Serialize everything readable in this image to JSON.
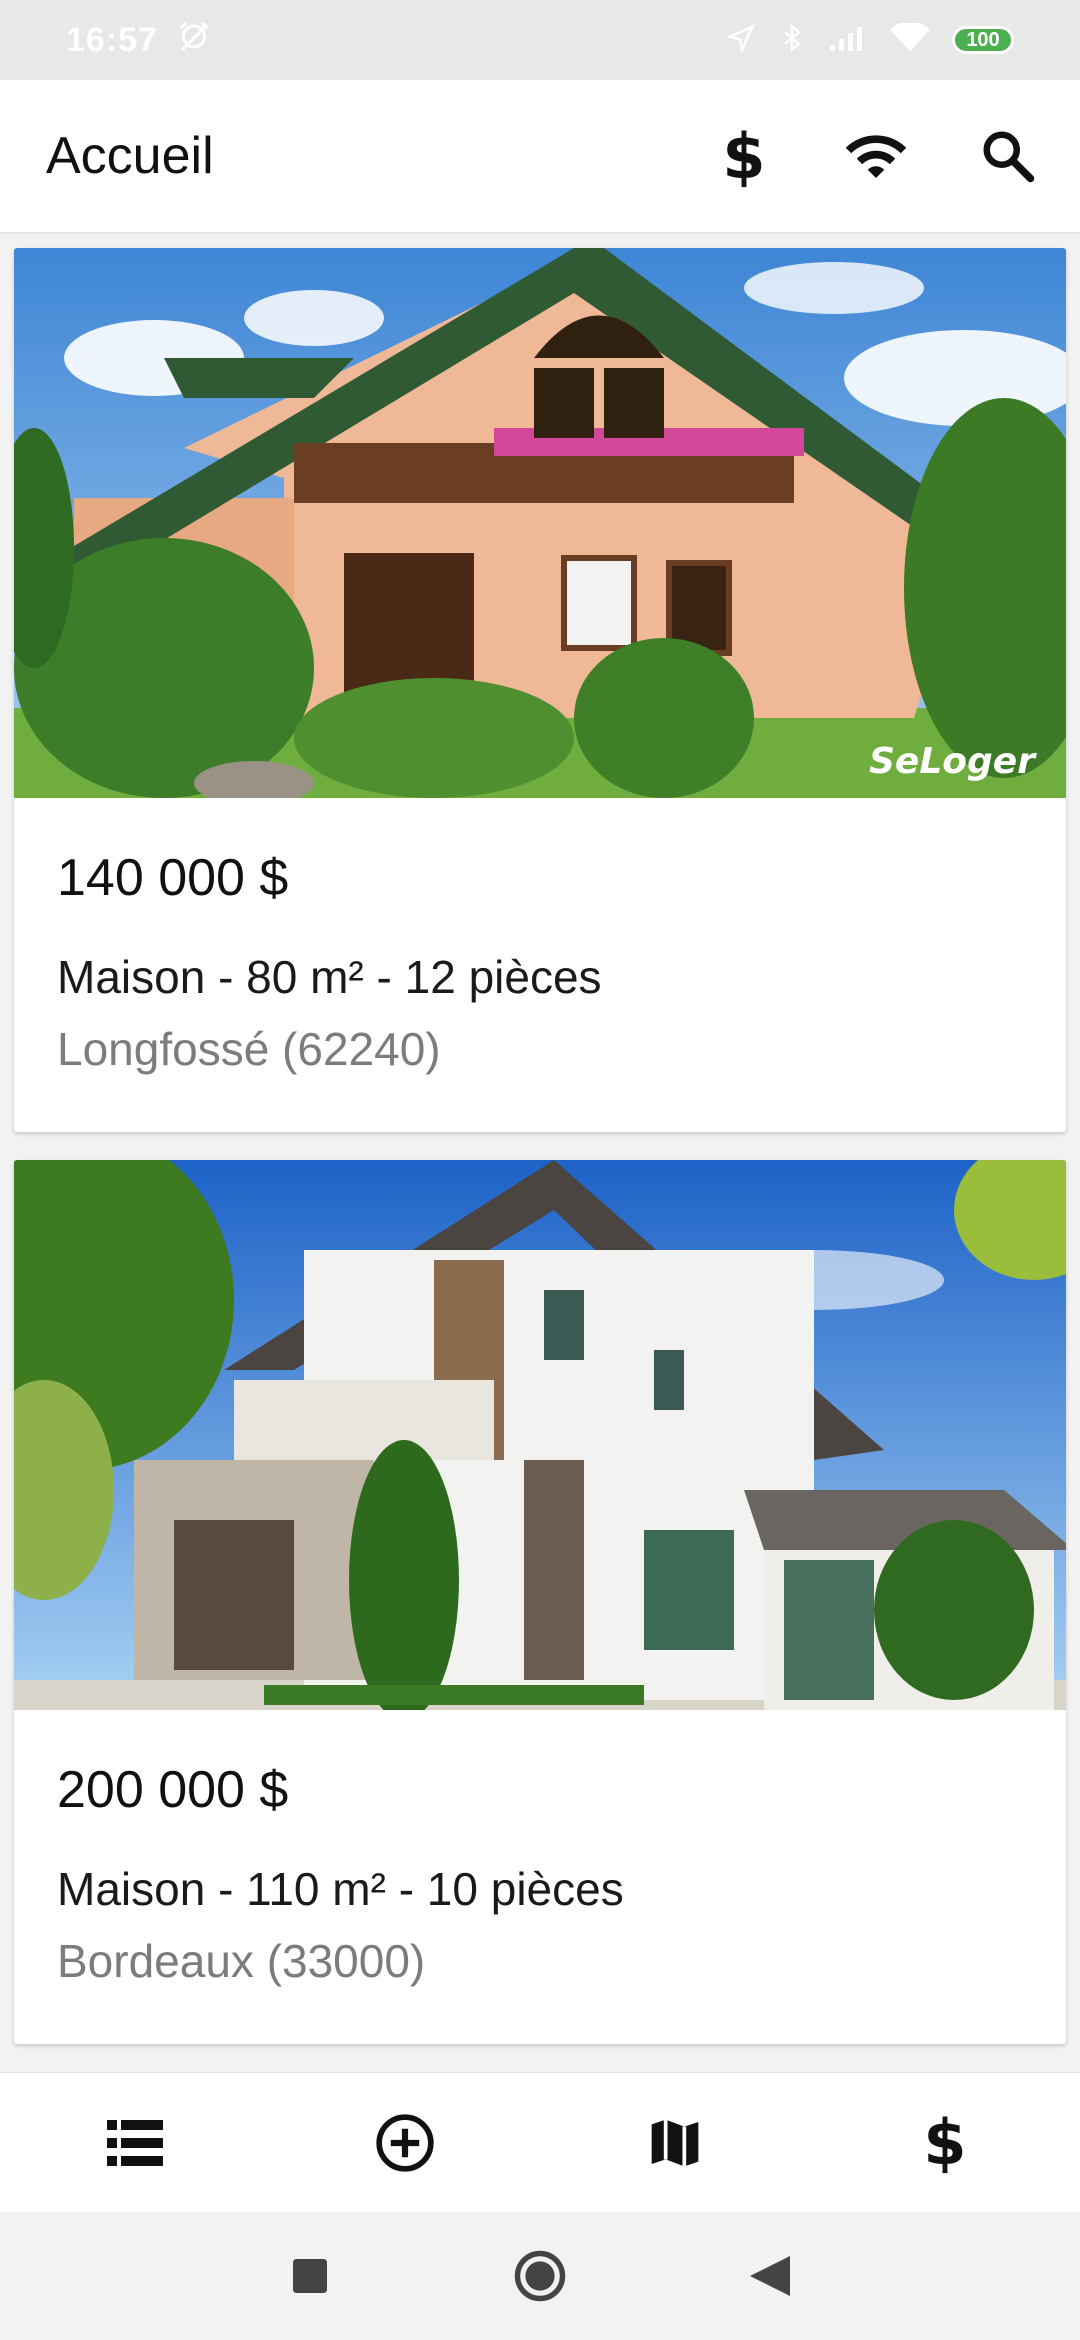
{
  "status_bar": {
    "time": "16:57",
    "battery": "100",
    "icons": [
      "alarm-off-icon",
      "location-icon",
      "bluetooth-icon",
      "signal-icon",
      "wifi-icon",
      "battery-icon"
    ]
  },
  "app_bar": {
    "title": "Accueil",
    "actions": [
      "currency-icon",
      "wifi-icon",
      "search-icon"
    ]
  },
  "listings": [
    {
      "price": "140 000 $",
      "details": "Maison - 80 m² - 12 pièces",
      "location": "Longfossé (62240)",
      "photo_logo": "SeLoger"
    },
    {
      "price": "200 000 $",
      "details": "Maison - 110 m² - 10 pièces",
      "location": "Bordeaux (33000)"
    }
  ],
  "bottom_nav": {
    "items": [
      "list-icon",
      "add-circle-icon",
      "map-icon",
      "currency-icon"
    ]
  },
  "colors": {
    "app_bar": "#ffffff",
    "status_bar": "#e8e8e8",
    "battery": "#4caf50",
    "secondary_text": "#7c7c7c"
  }
}
